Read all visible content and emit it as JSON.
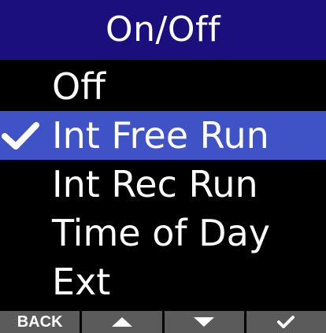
{
  "title": "On/Off",
  "menu": {
    "items": [
      {
        "label": "Off",
        "selected": false
      },
      {
        "label": "Int Free Run",
        "selected": true
      },
      {
        "label": "Int Rec Run",
        "selected": false
      },
      {
        "label": "Time of Day",
        "selected": false
      },
      {
        "label": "Ext",
        "selected": false
      }
    ],
    "check_icon": "checkmark-icon"
  },
  "footer": {
    "back_label": "BACK",
    "up_icon": "triangle-up-icon",
    "down_icon": "triangle-down-icon",
    "confirm_icon": "checkmark-icon"
  },
  "colors": {
    "title_bg": "#1b0f7e",
    "selection_bg": "#3f53c6",
    "background": "#000000",
    "softkey_bg": "#5b5b5b",
    "text": "#ffffff"
  }
}
